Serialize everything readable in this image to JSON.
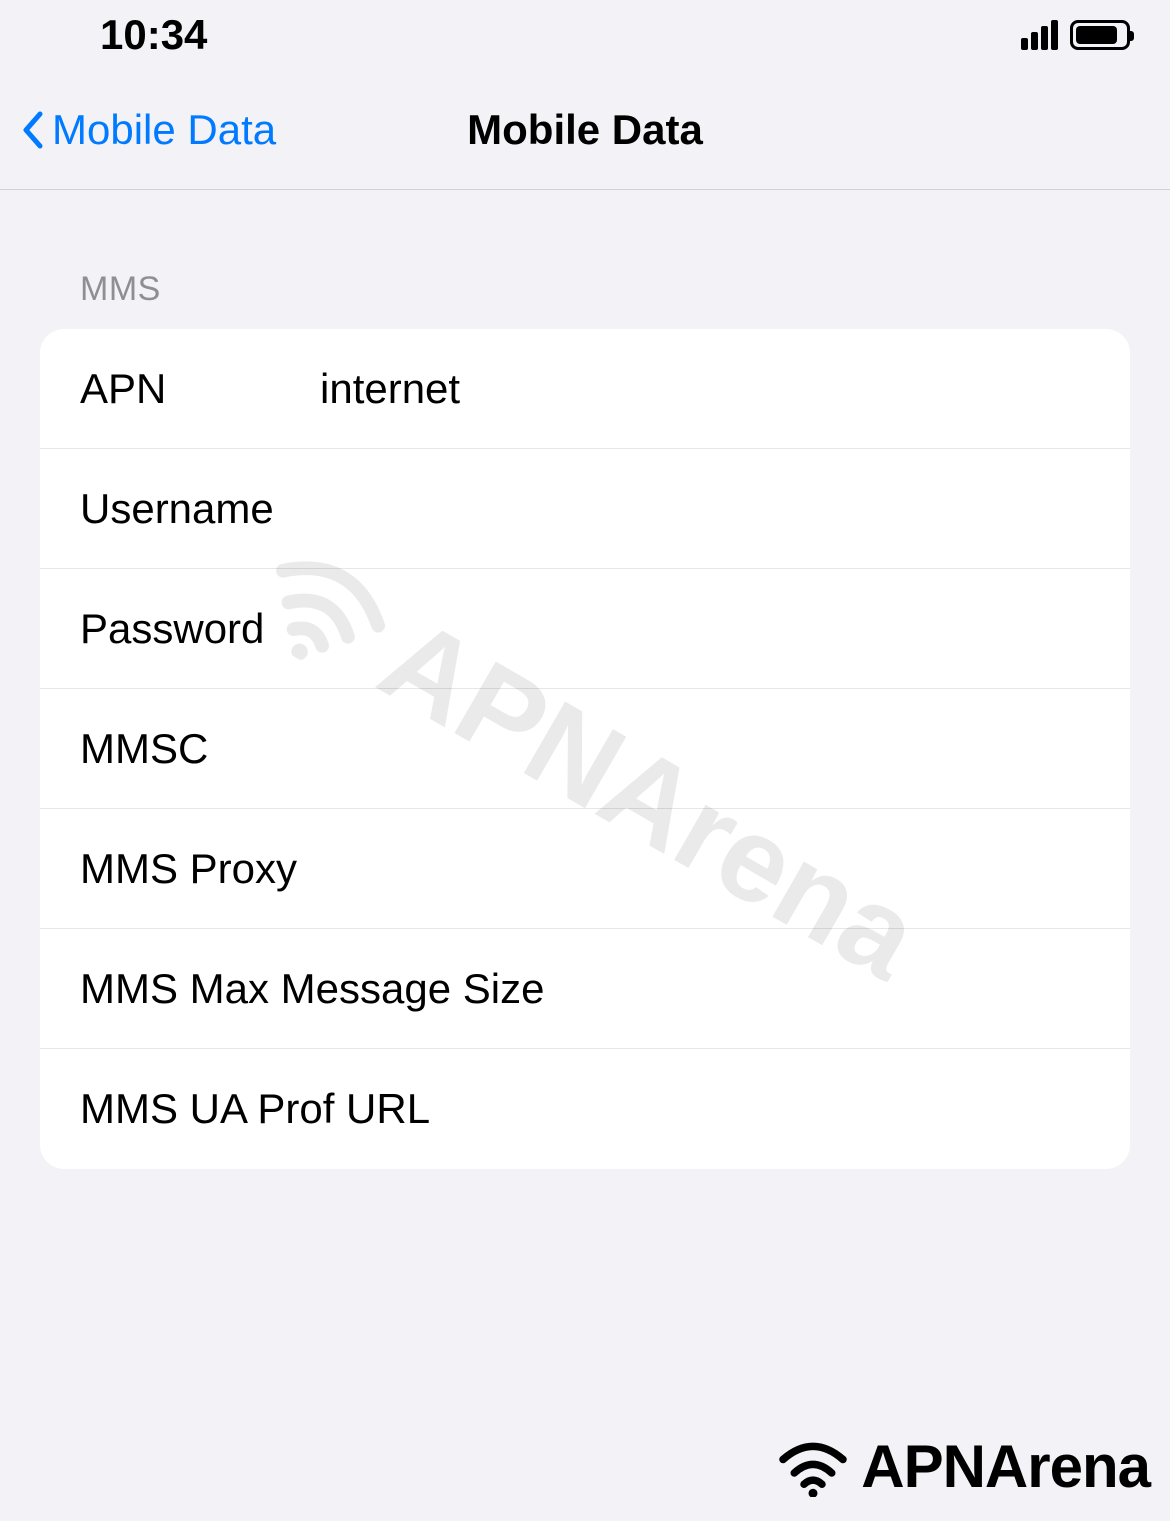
{
  "status_bar": {
    "time": "10:34"
  },
  "nav": {
    "back_label": "Mobile Data",
    "title": "Mobile Data"
  },
  "section": {
    "header": "MMS",
    "rows": [
      {
        "label": "APN",
        "value": "internet"
      },
      {
        "label": "Username",
        "value": ""
      },
      {
        "label": "Password",
        "value": ""
      },
      {
        "label": "MMSC",
        "value": ""
      },
      {
        "label": "MMS Proxy",
        "value": ""
      },
      {
        "label": "MMS Max Message Size",
        "value": ""
      },
      {
        "label": "MMS UA Prof URL",
        "value": ""
      }
    ]
  },
  "watermark": {
    "text": "APNArena"
  },
  "footer": {
    "text": "APNArena"
  }
}
